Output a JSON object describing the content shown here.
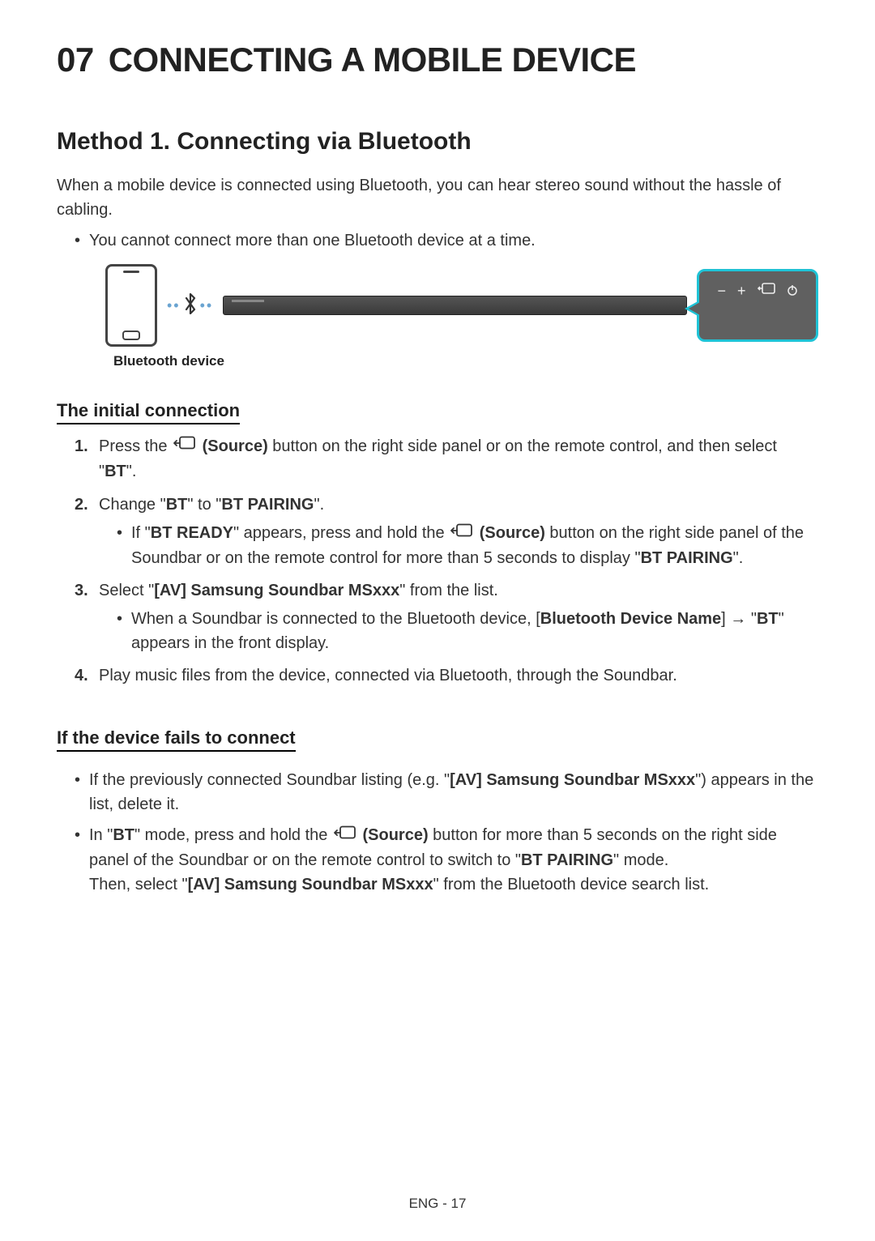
{
  "heading": {
    "chapter_number": "07",
    "chapter_title": "CONNECTING A MOBILE DEVICE"
  },
  "section": {
    "title": "Method 1. Connecting via Bluetooth",
    "intro": "When a mobile device is connected using Bluetooth, you can hear stereo sound without the hassle of cabling.",
    "note": "You cannot connect more than one Bluetooth device at a time."
  },
  "diagram": {
    "caption": "Bluetooth device",
    "panel_icons": {
      "minus": "−",
      "plus": "+",
      "source": "source",
      "power": "⏻"
    }
  },
  "initial": {
    "title": "The initial connection",
    "steps": [
      {
        "pre": "Press the ",
        "icon": true,
        "mid": " (Source)",
        "post": " button on the right side panel or on the remote control, and then select \"",
        "strong": "BT",
        "tail": "\"."
      },
      {
        "text_a": "Change \"",
        "b1": "BT",
        "text_b": "\" to \"",
        "b2": "BT PAIRING",
        "text_c": "\".",
        "sub": {
          "pre": "If \"",
          "b1": "BT READY",
          "mid": "\" appears, press and hold the ",
          "icon": true,
          "srclabel": " (Source)",
          "post1": " button on the right side panel of the Soundbar or on the remote control for more than 5 seconds to display \"",
          "b2": "BT PAIRING",
          "post2": "\"."
        }
      },
      {
        "text_a": "Select \"",
        "b1": "[AV] Samsung Soundbar MSxxx",
        "text_b": "\" from the list.",
        "sub": {
          "text_a": "When a Soundbar is connected to the Bluetooth device, [",
          "b1": "Bluetooth Device Name",
          "text_b": "] ",
          "arrow": "→",
          "text_c": " \"",
          "b2": "BT",
          "text_d": "\" appears in the front display."
        }
      },
      {
        "text": "Play music files from the device, connected via Bluetooth, through the Soundbar."
      }
    ]
  },
  "fails": {
    "title": "If the device fails to connect",
    "items": [
      {
        "text_a": "If the previously connected Soundbar listing (e.g. \"",
        "b1": "[AV] Samsung Soundbar MSxxx",
        "text_b": "\") appears in the list, delete it."
      },
      {
        "text_a": "In \"",
        "b1": "BT",
        "text_b": "\" mode, press and hold the ",
        "icon": true,
        "srclabel": " (Source)",
        "text_c": " button for more than 5 seconds on the right side panel of the Soundbar or on the remote control to switch to \"",
        "b2": "BT PAIRING",
        "text_d": "\" mode.",
        "line2_a": "Then, select \"",
        "b3": "[AV] Samsung Soundbar MSxxx",
        "line2_b": "\" from the Bluetooth device search list."
      }
    ]
  },
  "footer": "ENG - 17"
}
